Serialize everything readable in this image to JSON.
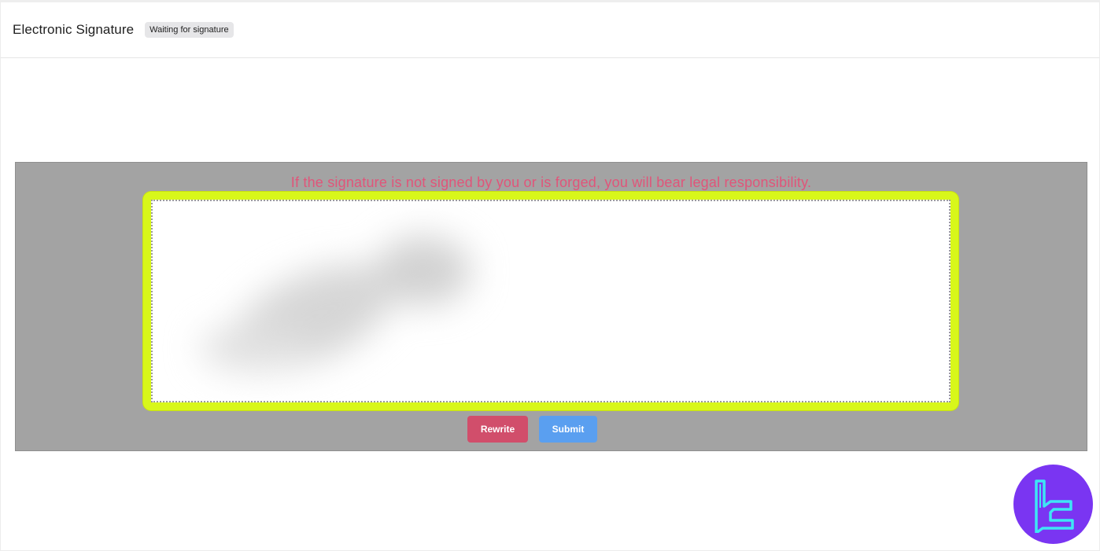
{
  "header": {
    "title": "Electronic Signature",
    "status_badge": "Waiting for signature"
  },
  "signature": {
    "warning": "If the signature is not signed by you or is forged, you will bear legal responsibility.",
    "rewrite_label": "Rewrite",
    "submit_label": "Submit"
  },
  "colors": {
    "warning_text": "#e0557a",
    "highlight_border": "#d8f71a",
    "rewrite_button": "#d14e6b",
    "submit_button": "#5a9ff0",
    "logo_bg": "#7a35f2",
    "logo_glyph": "#3ee6f5"
  },
  "watermark": {
    "icon": "brand-logo-icon"
  }
}
